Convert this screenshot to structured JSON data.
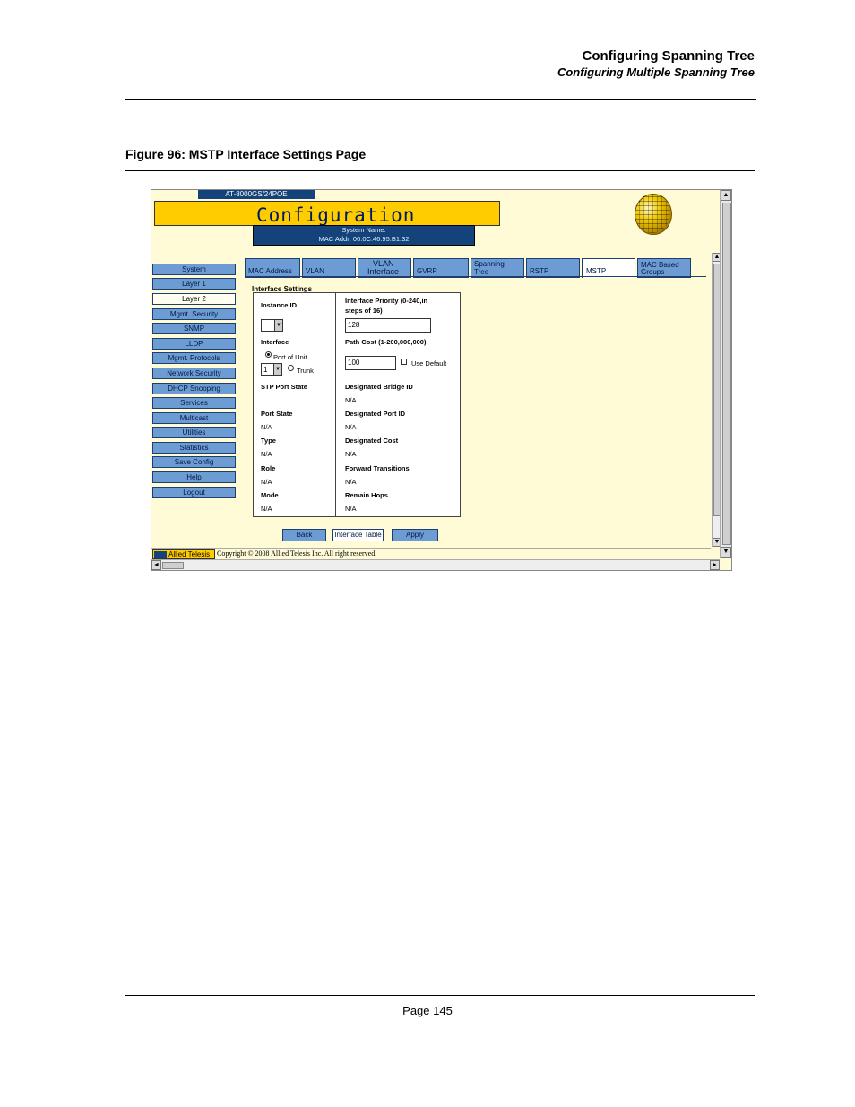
{
  "header": {
    "chapter_title": "Configuring Spanning Tree",
    "section_title": "Configuring Multiple Spanning Tree"
  },
  "figure": {
    "caption": "Figure 96:  MSTP Interface Settings Page"
  },
  "app": {
    "model": "AT-8000GS/24POE",
    "banner_title": "Configuration",
    "system_name_label": "System Name:",
    "mac_addr_label": "MAC Addr: 00:0C:46:95:B1:32"
  },
  "menu": {
    "items": [
      {
        "label": "System",
        "selected": false
      },
      {
        "label": "Layer 1",
        "selected": false
      },
      {
        "label": "Layer 2",
        "selected": true
      },
      {
        "label": "Mgmt. Security",
        "selected": false
      },
      {
        "label": "SNMP",
        "selected": false
      },
      {
        "label": "LLDP",
        "selected": false
      },
      {
        "label": "Mgmt. Protocols",
        "selected": false
      },
      {
        "label": "Network Security",
        "selected": false
      },
      {
        "label": "DHCP Snooping",
        "selected": false
      },
      {
        "label": "Services",
        "selected": false
      },
      {
        "label": "Multicast",
        "selected": false
      },
      {
        "label": "Utilities",
        "selected": false
      },
      {
        "label": "Statistics",
        "selected": false
      },
      {
        "label": "Save Config",
        "selected": false
      },
      {
        "label": "Help",
        "selected": false
      },
      {
        "label": "Logout",
        "selected": false
      }
    ]
  },
  "tabs": [
    {
      "line1": "MAC Address",
      "line2": ""
    },
    {
      "line1": "VLAN",
      "line2": ""
    },
    {
      "line1": "VLAN",
      "line2": "Interface"
    },
    {
      "line1": "GVRP",
      "line2": ""
    },
    {
      "line1": "Spanning",
      "line2": "Tree"
    },
    {
      "line1": "RSTP",
      "line2": ""
    },
    {
      "line1": "MSTP",
      "line2": ""
    },
    {
      "line1": "MAC Based",
      "line2": "Groups"
    }
  ],
  "panel": {
    "title": "Interface Settings",
    "instance_id_label": "Instance ID",
    "instance_id_value": "",
    "interface_label": "Interface",
    "port_of_unit_label": "Port of Unit",
    "trunk_label": "Trunk",
    "unit_value": "1",
    "stp_port_state_label": "STP Port State",
    "port_state_label": "Port State",
    "port_state_value": "N/A",
    "type_label": "Type",
    "type_value": "N/A",
    "role_label": "Role",
    "role_value": "N/A",
    "mode_label": "Mode",
    "mode_value": "N/A",
    "interface_priority_label_1": "Interface Priority (0-240,in",
    "interface_priority_label_2": "steps of 16)",
    "interface_priority_value": "128",
    "path_cost_label": "Path Cost (1-200,000,000)",
    "path_cost_value": "100",
    "use_default_label": "Use Default",
    "designated_bridge_id_label": "Designated Bridge ID",
    "designated_bridge_id_value": "N/A",
    "designated_port_id_label": "Designated Port ID",
    "designated_port_id_value": "N/A",
    "designated_cost_label": "Designated Cost",
    "designated_cost_value": "N/A",
    "forward_transitions_label": "Forward Transitions",
    "forward_transitions_value": "N/A",
    "remain_hops_label": "Remain Hops",
    "remain_hops_value": "N/A"
  },
  "buttons": {
    "back": "Back",
    "interface_table": "Interface Table",
    "apply": "Apply"
  },
  "footer": {
    "logo_text": "Allied Telesis",
    "copyright": "Copyright © 2008 Allied Telesis Inc. All right reserved.",
    "page_number": "Page 145"
  },
  "colors": {
    "banner": "#ffcc00",
    "menu_button": "#6d9bd3",
    "header_bar": "#13437a",
    "page_bg": "#fffbd6"
  }
}
